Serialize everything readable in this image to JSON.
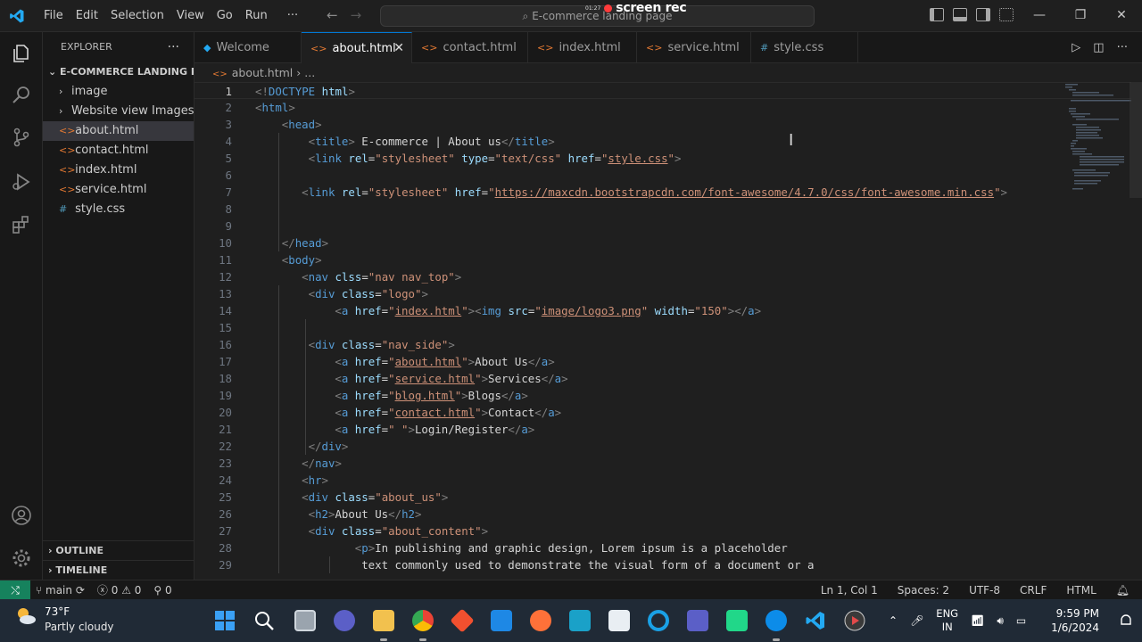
{
  "menu": [
    "File",
    "Edit",
    "Selection",
    "View",
    "Go",
    "Run",
    "···"
  ],
  "command_center": "E-commerce landing page",
  "recorder": {
    "time": "01:27",
    "label": "screen rec"
  },
  "explorer": {
    "header": "EXPLORER",
    "folder": "E-COMMERCE LANDING P...",
    "items": [
      {
        "label": "image",
        "kind": "folder"
      },
      {
        "label": "Website view Images",
        "kind": "folder"
      },
      {
        "label": "about.html",
        "kind": "html"
      },
      {
        "label": "contact.html",
        "kind": "html"
      },
      {
        "label": "index.html",
        "kind": "html"
      },
      {
        "label": "service.html",
        "kind": "html"
      },
      {
        "label": "style.css",
        "kind": "css"
      }
    ],
    "outline": "OUTLINE",
    "timeline": "TIMELINE"
  },
  "tabs": [
    {
      "label": "Welcome",
      "kind": "vscode"
    },
    {
      "label": "about.html",
      "kind": "html",
      "active": true
    },
    {
      "label": "contact.html",
      "kind": "html"
    },
    {
      "label": "index.html",
      "kind": "html"
    },
    {
      "label": "service.html",
      "kind": "html"
    },
    {
      "label": "style.css",
      "kind": "css"
    }
  ],
  "breadcrumb": {
    "file": "about.html",
    "more": "..."
  },
  "editor": {
    "line_numbers": [
      "1",
      "2",
      "3",
      "4",
      "5",
      "6",
      "7",
      "8",
      "9",
      "10",
      "11",
      "12",
      "13",
      "14",
      "15",
      "16",
      "17",
      "18",
      "19",
      "20",
      "21",
      "22",
      "23",
      "24",
      "25",
      "26",
      "27",
      "28",
      "29"
    ],
    "lines": [
      "<!DOCTYPE html>",
      "<html>",
      "<head>",
      "<title> E-commerce | About us</title>",
      "<link rel=\"stylesheet\" type=\"text/css\" href=\"style.css\">",
      "",
      "<link rel=\"stylesheet\" href=\"https://maxcdn.bootstrapcdn.com/font-awesome/4.7.0/css/font-awesome.min.css\">",
      "",
      "",
      "</head>",
      "<body>",
      "<nav clss=\"nav nav_top\">",
      "<div class=\"logo\">",
      "<a href=\"index.html\"><img src=\"image/logo3.png\" width=\"150\"></a>",
      "",
      "<div class=\"nav_side\">",
      "<a href=\"about.html\">About Us</a>",
      "<a href=\"service.html\">Services</a>",
      "<a href=\"blog.html\">Blogs</a>",
      "<a href=\"contact.html\">Contact</a>",
      "<a href=\" \">Login/Register</a>",
      "</div>",
      "</nav>",
      "<hr>",
      "<div class=\"about_us\">",
      "<h2>About Us</h2>",
      "<div class=\"about_content\">",
      "<p>In publishing and graphic design, Lorem ipsum is a placeholder",
      "text commonly used to demonstrate the visual form of a document or a"
    ]
  },
  "statusbar": {
    "branch": "main",
    "errors": "0",
    "warnings": "0",
    "ports": "0",
    "position": "Ln 1, Col 1",
    "spaces": "Spaces: 2",
    "encoding": "UTF-8",
    "eol": "CRLF",
    "language": "HTML"
  },
  "taskbar": {
    "temperature": "73°F",
    "condition": "Partly cloudy",
    "lang_1": "ENG",
    "lang_2": "IN",
    "time": "9:59 PM",
    "date": "1/6/2024"
  },
  "colors": {
    "accent": "#0078d4",
    "remote": "#16825d",
    "html_icon": "#e37933",
    "css_icon": "#519aba"
  }
}
